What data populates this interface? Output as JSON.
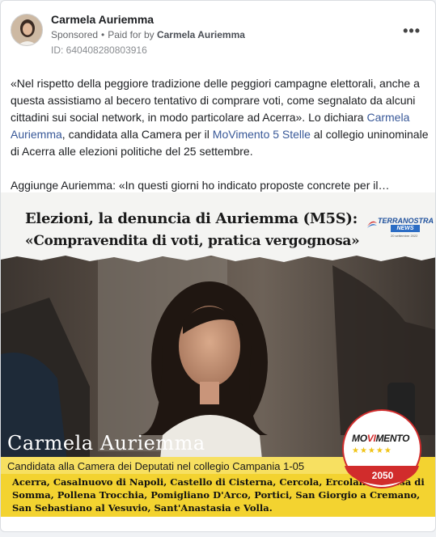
{
  "post": {
    "author_name": "Carmela Auriemma",
    "sponsored_label": "Sponsored",
    "paid_prefix": "Paid for by",
    "payer_name": "Carmela Auriemma",
    "id_line": "ID: 640408280803916",
    "more_button": "•••",
    "paragraph1_a": "«Nel rispetto della peggiore tradizione delle peggiori campagne elettorali, anche a questa assistiamo al becero tentativo di comprare voti, come segnalato da alcuni cittadini sui social network, in modo particolare ad Acerra». Lo dichiara ",
    "paragraph1_link1": "Carmela Auriemma",
    "paragraph1_b": ", candidata alla Camera per il ",
    "paragraph1_link2": "MoVimento 5 Stelle",
    "paragraph1_c": " al collegio uninominale di Acerra alle elezioni politiche del 25 settembre.",
    "paragraph2": "Aggiunge Auriemma: «In questi giorni ho indicato proposte concrete per il…"
  },
  "ad_image": {
    "headline_line1": "Elezioni, la denuncia di Auriemma (M5S):",
    "headline_line2": "«Compravendita di voti, pratica vergognosa»",
    "logo_title": "TERRANOSTRA",
    "logo_news": "NEWS",
    "logo_date": "20 settembre 2022",
    "candidate_name": "Carmela Auriemma",
    "subtitle": "Candidata alla Camera dei Deputati nel collegio Campania 1-05",
    "towns": "Acerra, Casalnuovo di Napoli, Castello di Cisterna, Cercola, Ercolano, Massa di Somma, Pollena Trocchia, Pomigliano D'Arco, Portici, San Giorgio a Cremano, San Sebastiano al Vesuvio, Sant'Anastasia e Volla.",
    "party_logo_text_a": "MO",
    "party_logo_text_b": "VI",
    "party_logo_text_c": "MENTO",
    "party_logo_stars": "★★★★★",
    "party_logo_year": "2050"
  },
  "colors": {
    "link": "#385898",
    "band_yellow": "#f3d330",
    "party_red": "#d12c2c"
  }
}
